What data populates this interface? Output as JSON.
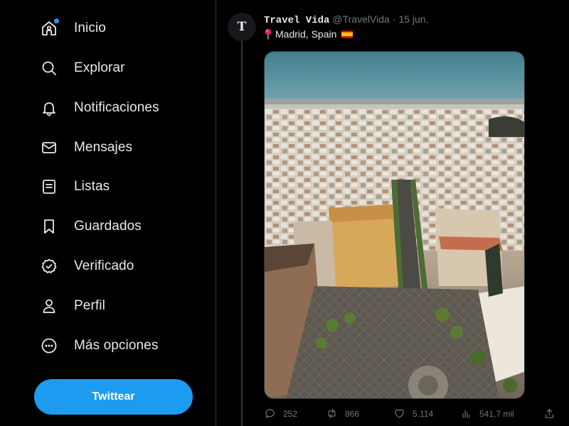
{
  "sidebar": {
    "items": [
      {
        "label": "Inicio",
        "icon": "home-icon"
      },
      {
        "label": "Explorar",
        "icon": "search-icon"
      },
      {
        "label": "Notificaciones",
        "icon": "bell-icon"
      },
      {
        "label": "Mensajes",
        "icon": "envelope-icon"
      },
      {
        "label": "Listas",
        "icon": "list-icon"
      },
      {
        "label": "Guardados",
        "icon": "bookmark-icon"
      },
      {
        "label": "Verificado",
        "icon": "verified-icon"
      },
      {
        "label": "Perfil",
        "icon": "person-icon"
      },
      {
        "label": "Más opciones",
        "icon": "more-circle-icon"
      }
    ],
    "tweet_button": "Twittear"
  },
  "tweet": {
    "avatar_letter": "T",
    "display_name": "Travel Vida",
    "handle": "@TravelVida",
    "separator": "·",
    "date": "15 jun.",
    "text": "Madrid, Spain",
    "text_icons": [
      "pin-icon",
      "spain-flag-icon"
    ],
    "photo": "aerial-city-photo",
    "stats": {
      "replies": "252",
      "retweets": "866",
      "likes": "5.114",
      "views": "541,7 mil"
    }
  },
  "colors": {
    "background": "#000000",
    "accent": "#1d9bf0",
    "text": "#e7e9ea",
    "muted": "#71767b",
    "border": "#2f3336"
  }
}
